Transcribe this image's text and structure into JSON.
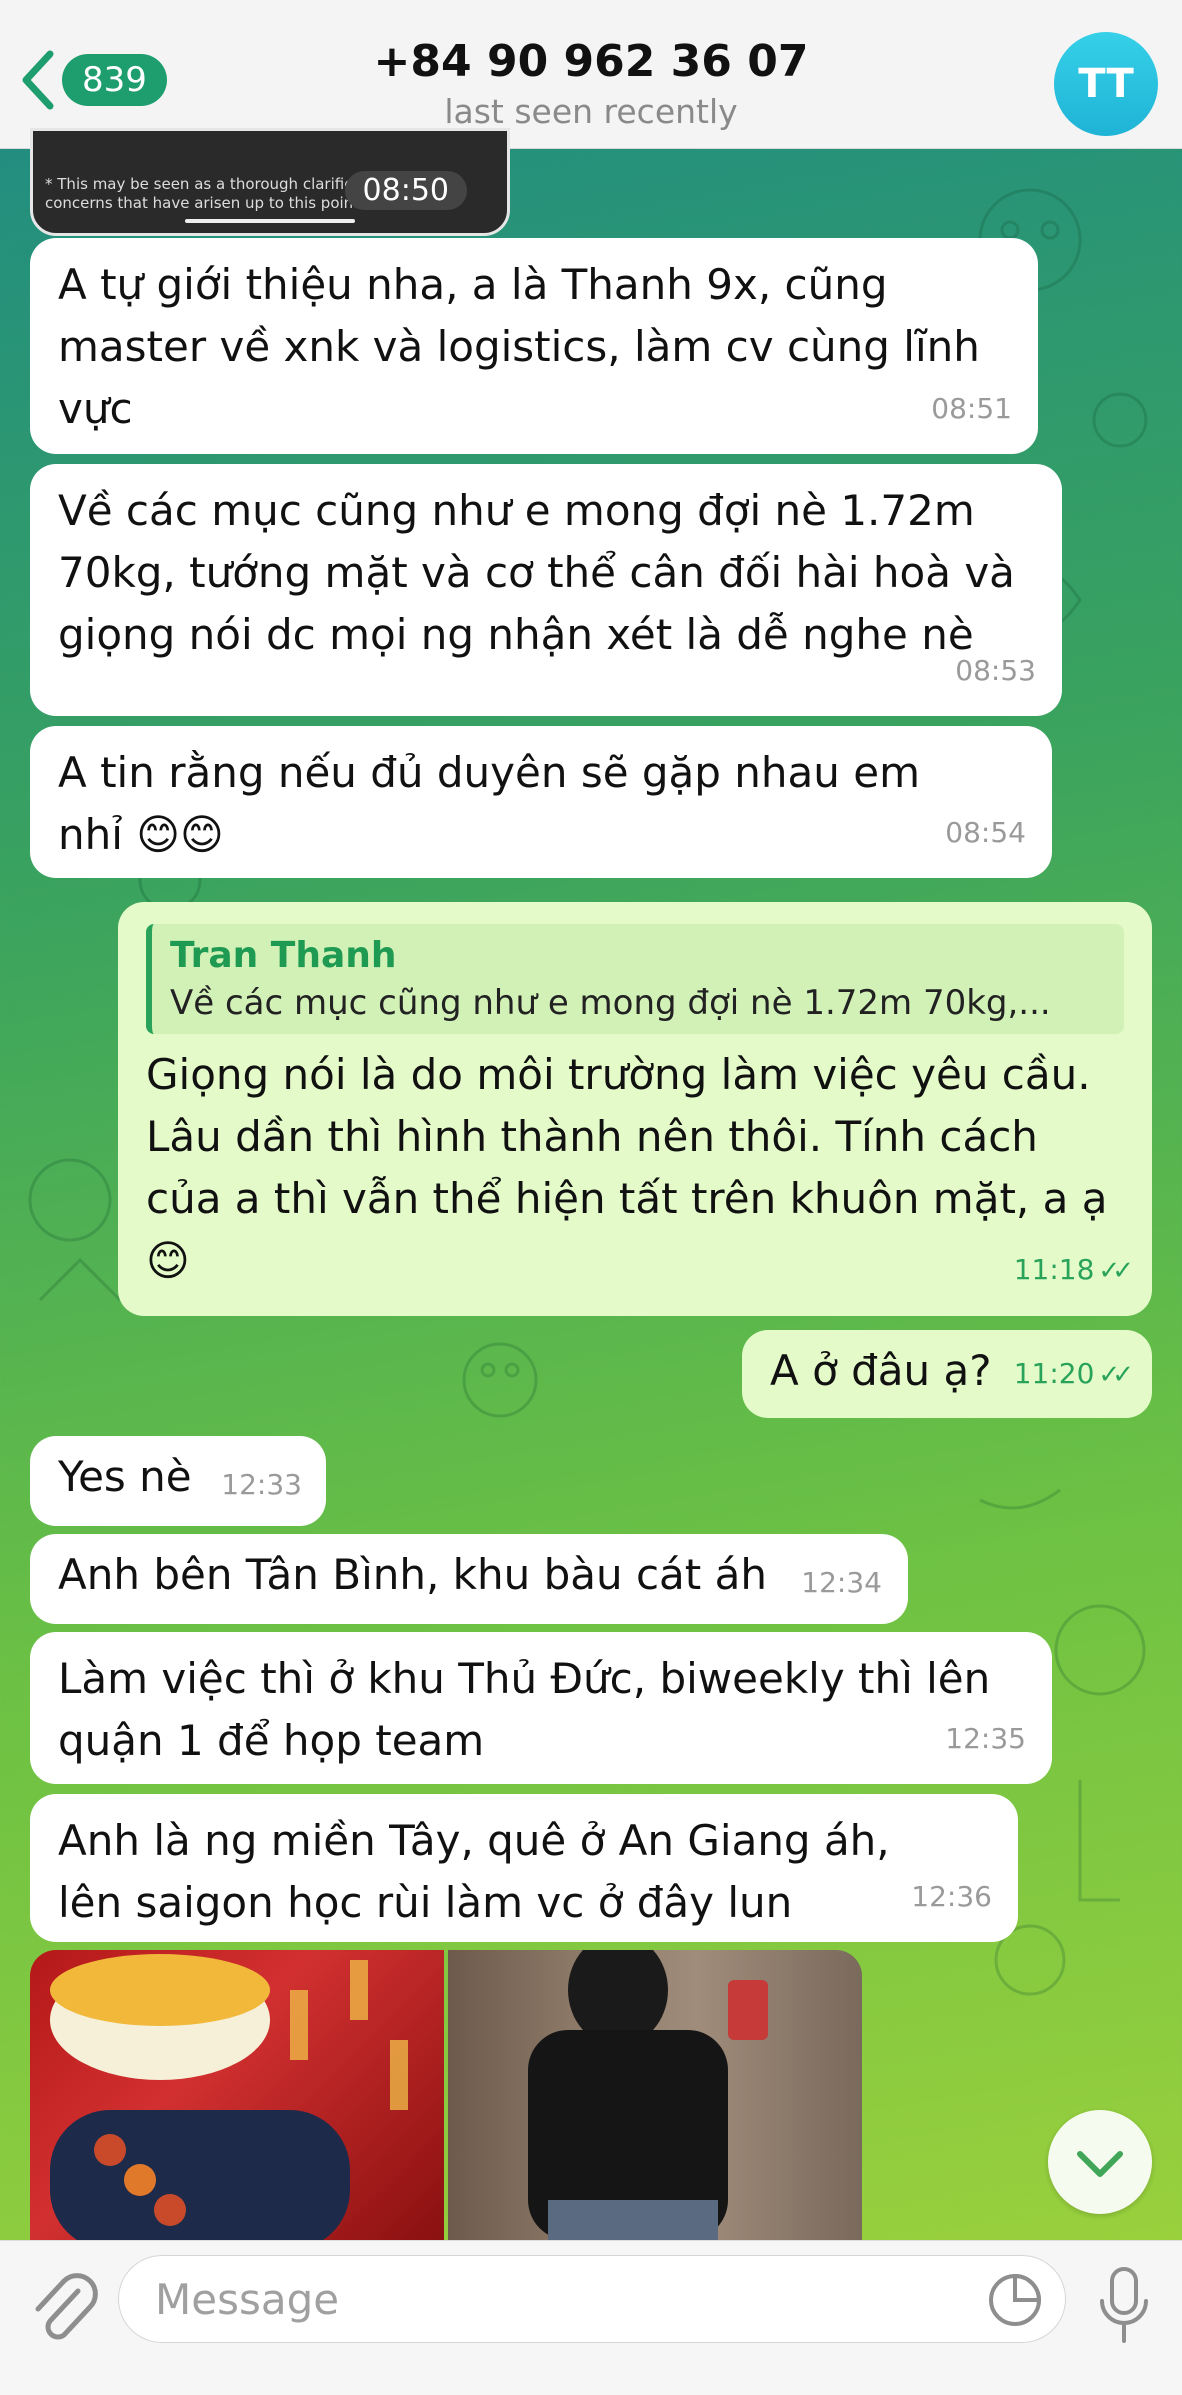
{
  "header": {
    "back_count": "839",
    "title": "+84 90 962 36 07",
    "subtitle": "last seen recently",
    "avatar_initials": "TT"
  },
  "video": {
    "caption": "* This may be seen as a thorough clarification of all the concerns that have arisen up to this point ^^",
    "time": "08:50"
  },
  "messages": [
    {
      "text": "A tự giới thiệu nha, a là Thanh 9x, cũng master về xnk và logistics, làm cv cùng lĩnh vực",
      "time": "08:51"
    },
    {
      "text": "Về các mục cũng như e mong đợi nè 1.72m 70kg, tướng mặt và cơ thể cân đối hài hoà và giọng nói dc mọi ng nhận xét là dễ nghe nè",
      "time": "08:53"
    },
    {
      "text": "A tin rằng nếu đủ duyên sẽ gặp nhau em nhỉ 😊😊",
      "time": "08:54"
    },
    {
      "reply_name": "Tran Thanh",
      "reply_text": "Về các mục cũng như e mong đợi nè 1.72m 70kg,...",
      "text": "Giọng nói là do môi trường làm việc yêu cầu. Lâu dần thì hình thành nên thôi. Tính cách của a thì vẫn thể hiện tất trên khuôn mặt, a ạ 😊",
      "time": "11:18"
    },
    {
      "text": "A ở đâu ạ?",
      "time": "11:20"
    },
    {
      "text": "Yes nè",
      "time": "12:33"
    },
    {
      "text": "Anh bên Tân Bình, khu bàu cát áh",
      "time": "12:34"
    },
    {
      "text": "Làm việc thì ở khu Thủ Đức, biweekly thì lên quận 1 để họp team",
      "time": "12:35"
    },
    {
      "text": "Anh là ng miền Tây, quê ở An Giang áh, lên saigon học rùi làm vc ở đây lun",
      "time": "12:36"
    }
  ],
  "composer": {
    "placeholder": "Message"
  },
  "icons": [
    "back-chevron-icon",
    "attach-icon",
    "sticker-icon",
    "mic-icon",
    "chevron-down-icon",
    "read-checks-icon"
  ],
  "colors": {
    "incoming_bubble": "#ffffff",
    "outgoing_bubble": "#e4fbc9",
    "accent": "#1e9e6e",
    "reply_name": "#1f9a52"
  }
}
